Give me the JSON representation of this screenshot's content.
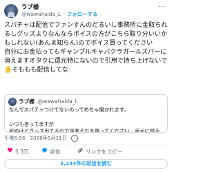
{
  "post": {
    "author_name": "ラブ様",
    "handle": "@wawahaida_L",
    "separator": "·",
    "follow_label": "フォローする",
    "more_label": "···",
    "body": "スパチャは配信でファンすんのだるいし事務所に金取られるしグッズよりなんならボイスの方がこちら取り分いいかもしれない(あんま知らん)のでボイス買ってください\n自分にお金払ってもギャンブルキャバクラガールズバーに消えますオタクに還元特にないので引用で持ち上げないで🖐️そももも配信してな",
    "timestamp": "午後5:56 · 2026年5月11日",
    "info_label": "i"
  },
  "quoted": {
    "author_name": "ラブ様",
    "handle": "@wawahaida_L",
    "text": "なんでスパチャつけてないのってめちゃ聞かれます。\n\nいつも言ってますが\n死ぬほどグッズ出てるので是非それを買ってください、手元に残るからそれでもお金が余ってるなら貯めといてください\nきっと将来役に立ちます。"
  },
  "actions": {
    "like_icon": "heart-icon",
    "like_count": "5.3万",
    "reply_icon": "reply-icon",
    "reply_label": "返信",
    "link_icon": "link-icon",
    "link_label": "リンクをコピー"
  },
  "read_replies_label": "3,234件の返信を読む",
  "colors": {
    "accent": "#1d9bf0",
    "like": "#f91880",
    "secondary_text": "#536471",
    "border": "#cfd9de"
  }
}
